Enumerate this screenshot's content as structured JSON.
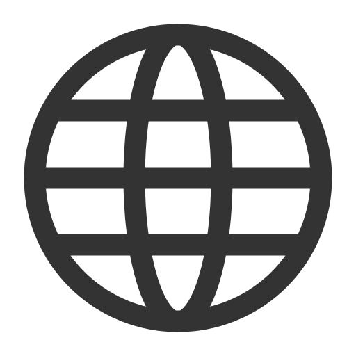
{
  "icon": {
    "name": "globe-icon",
    "color": "#333333",
    "background": "#ffffff"
  }
}
